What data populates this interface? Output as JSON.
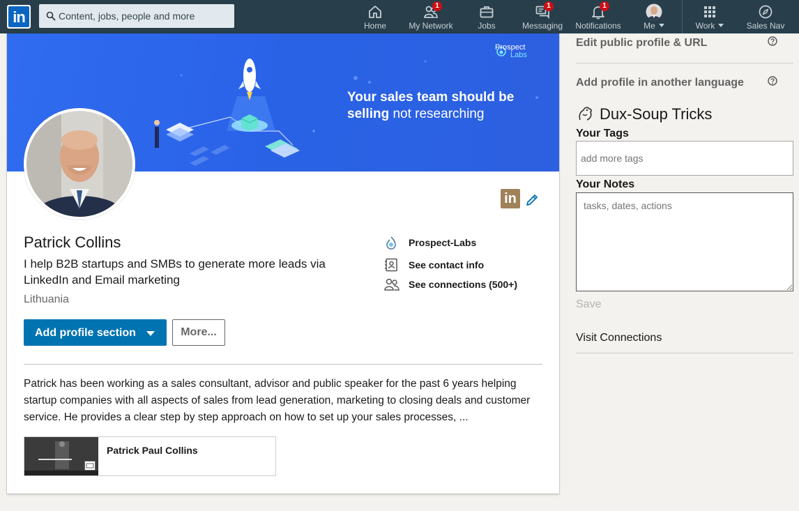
{
  "nav": {
    "search_placeholder": "Content, jobs, people and more",
    "items": [
      {
        "label": "Home",
        "icon": "home-icon"
      },
      {
        "label": "My Network",
        "icon": "network-icon",
        "badge": "1"
      },
      {
        "label": "Jobs",
        "icon": "briefcase-icon"
      },
      {
        "label": "Messaging",
        "icon": "messaging-icon",
        "badge": "1"
      },
      {
        "label": "Notifications",
        "icon": "bell-icon",
        "badge": "1"
      },
      {
        "label": "Me",
        "icon": "avatar"
      },
      {
        "label": "Work",
        "icon": "grid-icon"
      },
      {
        "label": "Sales Nav",
        "icon": "compass-icon"
      }
    ]
  },
  "banner": {
    "headline_bold1": "Your sales team should be",
    "headline_bold2": "selling",
    "headline_light": "not researching",
    "brand_line1": "Prospect",
    "brand_line2": "Labs"
  },
  "profile": {
    "name": "Patrick Collins",
    "headline": "I help B2B startups and SMBs to generate more leads via LinkedIn and Email marketing",
    "location": "Lithuania",
    "company": "Prospect-Labs",
    "contact_info": "See contact info",
    "connections": "See connections (500+)",
    "add_section_label": "Add profile section",
    "more_label": "More...",
    "summary": "Patrick has been working as a sales consultant, advisor and public speaker for the past 6 years helping startup companies with all aspects of sales from lead generation, marketing to closing deals and customer service. He provides a clear step by step approach on how to set up your sales processes, ...",
    "media_title": "Patrick Paul Collins"
  },
  "rail": {
    "edit_public_profile": "Edit public profile & URL",
    "add_language": "Add profile in another language",
    "dux_title": "Dux-Soup Tricks",
    "tags_label": "Your Tags",
    "tags_placeholder": "add more tags",
    "notes_label": "Your Notes",
    "notes_placeholder": "tasks, dates, actions",
    "save_label": "Save",
    "visit_connections": "Visit Connections"
  },
  "colors": {
    "nav_bg": "#283e4a",
    "primary": "#0073b1",
    "badge": "#cc1016",
    "banner": "#2a62e6"
  }
}
